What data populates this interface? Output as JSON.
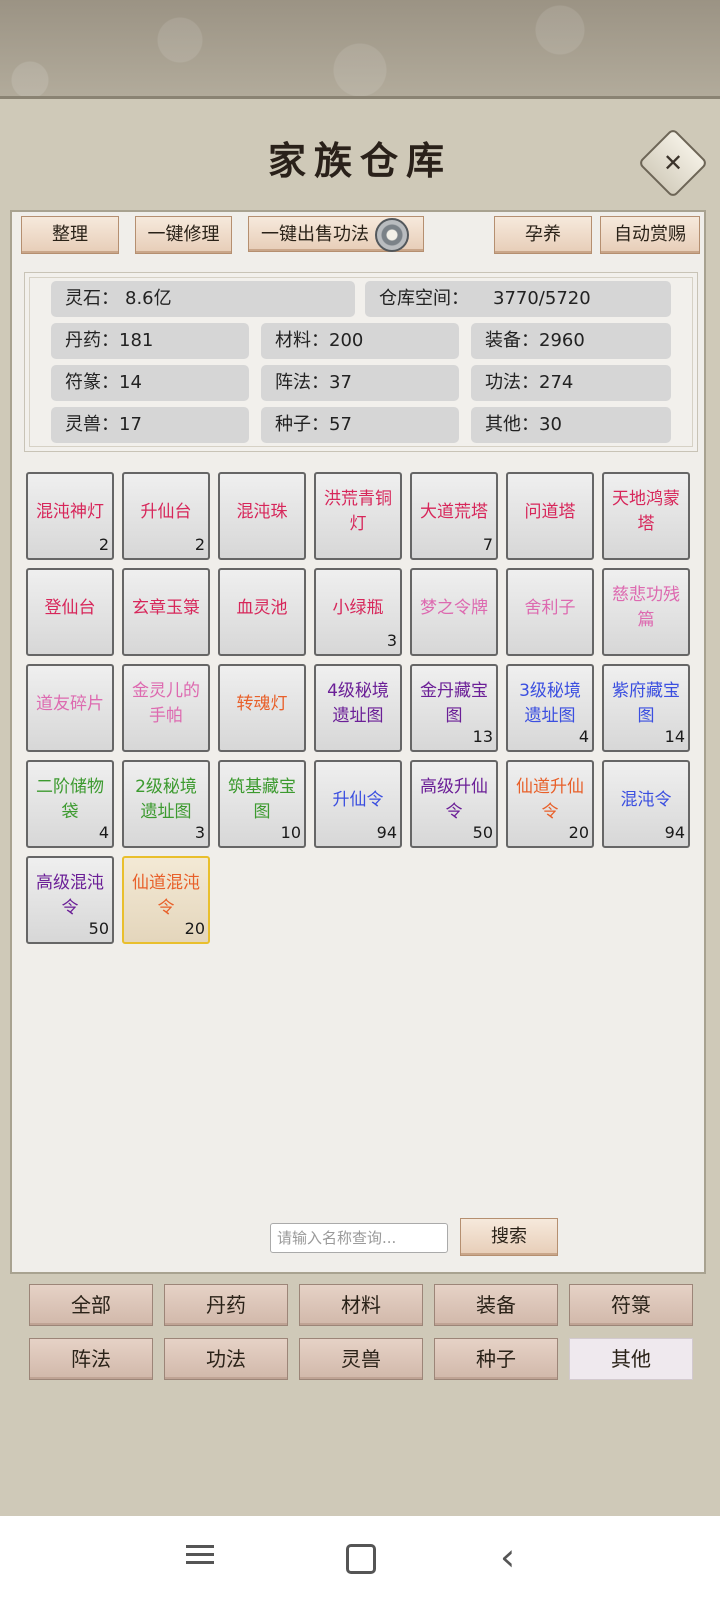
{
  "title": "家族仓库",
  "toolbar": {
    "sort": "整理",
    "repair": "一键修理",
    "sell_skills": "一键出售功法",
    "nurture": "孕养",
    "auto_reward": "自动赏赐"
  },
  "stats": {
    "spirit_stone_label": "灵石：",
    "spirit_stone_value": "8.6亿",
    "space_label": "仓库空间：",
    "space_value": "3770/5720",
    "pills": "丹药：181",
    "materials": "材料：200",
    "equipment": "装备：2960",
    "talismans": "符篆：14",
    "formations": "阵法：37",
    "skills": "功法：274",
    "beasts": "灵兽：17",
    "seeds": "种子：57",
    "others": "其他：30"
  },
  "colors": {
    "red": "#d7265a",
    "pink": "#dd6ab0",
    "orange": "#e8602a",
    "purple": "#6b1f97",
    "blue": "#3b4fe0",
    "green": "#3c9a2f"
  },
  "items": [
    {
      "name": "混沌神灯",
      "count": "2",
      "color": "red"
    },
    {
      "name": "升仙台",
      "count": "2",
      "color": "red"
    },
    {
      "name": "混沌珠",
      "count": "",
      "color": "red"
    },
    {
      "name": "洪荒青铜灯",
      "count": "",
      "color": "red"
    },
    {
      "name": "大道荒塔",
      "count": "7",
      "color": "red"
    },
    {
      "name": "问道塔",
      "count": "",
      "color": "red"
    },
    {
      "name": "天地鸿蒙塔",
      "count": "",
      "color": "red"
    },
    {
      "name": "登仙台",
      "count": "",
      "color": "red"
    },
    {
      "name": "玄章玉箓",
      "count": "",
      "color": "red"
    },
    {
      "name": "血灵池",
      "count": "",
      "color": "red"
    },
    {
      "name": "小绿瓶",
      "count": "3",
      "color": "red"
    },
    {
      "name": "梦之令牌",
      "count": "",
      "color": "pink"
    },
    {
      "name": "舍利子",
      "count": "",
      "color": "pink"
    },
    {
      "name": "慈悲功残篇",
      "count": "",
      "color": "pink"
    },
    {
      "name": "道友碎片",
      "count": "",
      "color": "pink"
    },
    {
      "name": "金灵儿的手帕",
      "count": "",
      "color": "pink"
    },
    {
      "name": "转魂灯",
      "count": "",
      "color": "orange"
    },
    {
      "name": "4级秘境遗址图",
      "count": "",
      "color": "purple"
    },
    {
      "name": "金丹藏宝图",
      "count": "13",
      "color": "purple"
    },
    {
      "name": "3级秘境遗址图",
      "count": "4",
      "color": "blue"
    },
    {
      "name": "紫府藏宝图",
      "count": "14",
      "color": "blue"
    },
    {
      "name": "二阶储物袋",
      "count": "4",
      "color": "green"
    },
    {
      "name": "2级秘境遗址图",
      "count": "3",
      "color": "green"
    },
    {
      "name": "筑基藏宝图",
      "count": "10",
      "color": "green"
    },
    {
      "name": "升仙令",
      "count": "94",
      "color": "blue"
    },
    {
      "name": "高级升仙令",
      "count": "50",
      "color": "purple"
    },
    {
      "name": "仙道升仙令",
      "count": "20",
      "color": "orange"
    },
    {
      "name": "混沌令",
      "count": "94",
      "color": "blue"
    },
    {
      "name": "高级混沌令",
      "count": "50",
      "color": "purple"
    },
    {
      "name": "仙道混沌令",
      "count": "20",
      "color": "orange",
      "selected": true
    }
  ],
  "search": {
    "placeholder": "请输入名称查询...",
    "button": "搜索"
  },
  "categories": [
    "全部",
    "丹药",
    "材料",
    "装备",
    "符箓",
    "阵法",
    "功法",
    "灵兽",
    "种子",
    "其他"
  ],
  "active_category": "其他",
  "icons": {
    "close": "close-icon",
    "gear": "gear-icon",
    "menu": "menu-icon",
    "home": "home-icon",
    "back": "back-icon"
  }
}
